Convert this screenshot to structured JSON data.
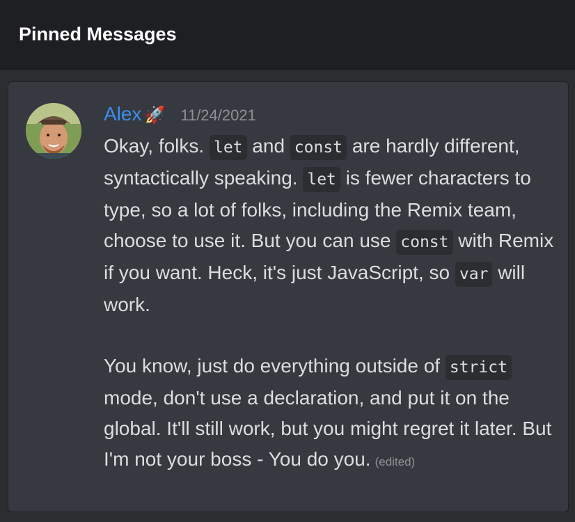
{
  "header": {
    "title": "Pinned Messages"
  },
  "message": {
    "author": "Alex",
    "author_emoji": "🚀",
    "timestamp": "11/24/2021",
    "p1": [
      {
        "text": "Okay, folks. ",
        "code": false
      },
      {
        "text": "let",
        "code": true
      },
      {
        "text": " and ",
        "code": false
      },
      {
        "text": "const",
        "code": true
      },
      {
        "text": " are hardly different, syntactically speaking. ",
        "code": false
      },
      {
        "text": "let",
        "code": true
      },
      {
        "text": " is fewer characters to type, so a lot of folks, including the Remix team, choose to use it. But you can use ",
        "code": false
      },
      {
        "text": "const",
        "code": true
      },
      {
        "text": " with Remix if you want. Heck, it's just JavaScript, so ",
        "code": false
      },
      {
        "text": "var",
        "code": true
      },
      {
        "text": " will work.",
        "code": false
      }
    ],
    "p2": [
      {
        "text": "You know, just do everything outside of ",
        "code": false
      },
      {
        "text": "strict",
        "code": true
      },
      {
        "text": " mode, don't use a declaration, and put it on the global. It'll still work, but you might regret it later. But I'm not your boss - You do you.",
        "code": false
      }
    ],
    "edited_label": "(edited)"
  },
  "colors": {
    "author": "#3b8ef0",
    "background": "#2b2d31",
    "card": "#36393f",
    "header": "#1e1f22"
  }
}
